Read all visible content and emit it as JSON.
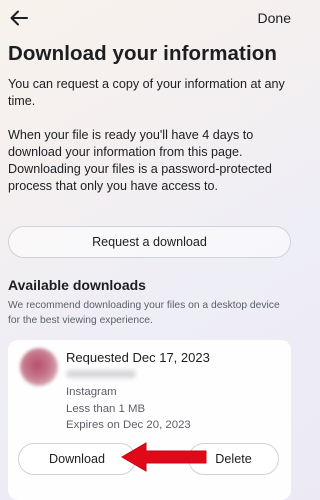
{
  "header": {
    "back_icon": "arrow-left-icon",
    "done_label": "Done"
  },
  "page": {
    "title": "Download your information",
    "intro": "You can request a copy of your information at any time.",
    "details": "When your file is ready you'll have 4 days to download your information from this page. Downloading your files is a password-protected process that only you have access to.",
    "request_button_label": "Request a download"
  },
  "available": {
    "title": "Available downloads",
    "subtitle": "We recommend downloading your files on a desktop device for the best viewing experience.",
    "item": {
      "requested": "Requested Dec 17, 2023",
      "platform": "Instagram",
      "size": "Less than 1 MB",
      "expires": "Expires on Dec 20, 2023",
      "download_label": "Download",
      "delete_label": "Delete"
    }
  },
  "annotation": {
    "arrow_color": "#e0091a"
  }
}
